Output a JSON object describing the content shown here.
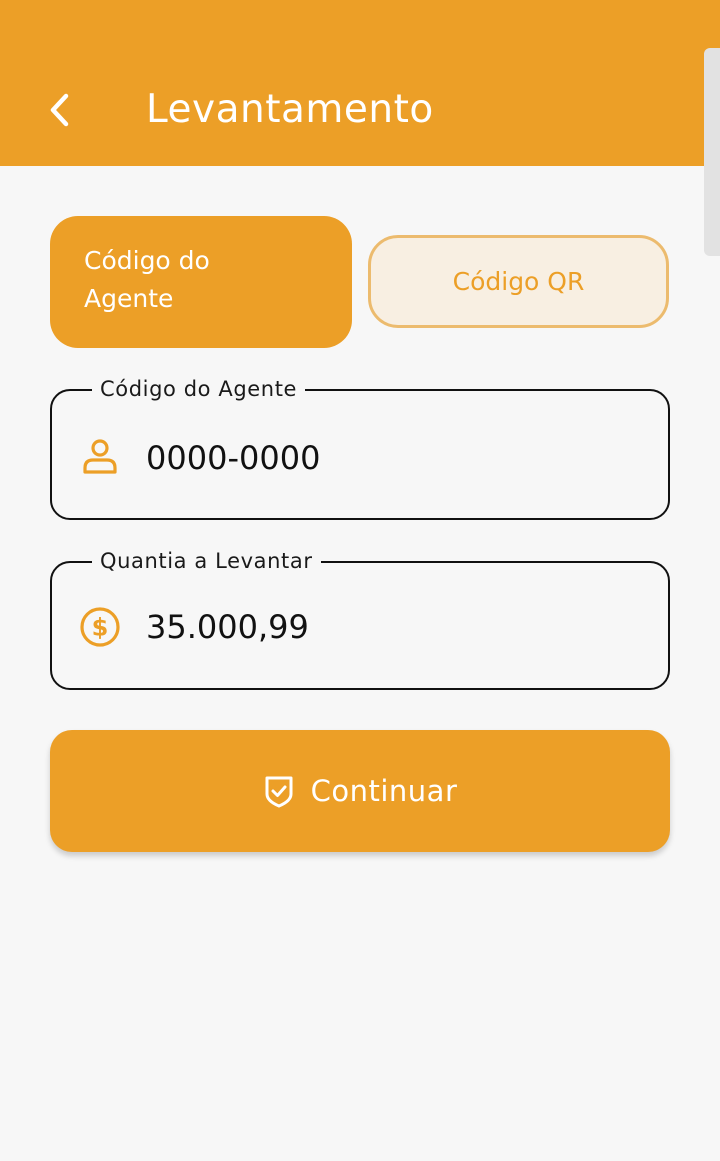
{
  "header": {
    "title": "Levantamento",
    "back_icon": "chevron-left-icon"
  },
  "toggle": {
    "agent_code_label": "Código do\nAgente",
    "qr_code_label": "Código QR",
    "selected": "agent_code"
  },
  "form": {
    "agent_code": {
      "label": "Código do Agente",
      "value": "0000-0000",
      "icon": "user-icon"
    },
    "amount": {
      "label": "Quantia a Levantar",
      "value": "35.000,99",
      "icon": "dollar-circle-icon"
    }
  },
  "actions": {
    "continue_label": "Continuar",
    "continue_icon": "shield-check-icon"
  },
  "colors": {
    "accent": "#ec9f27",
    "accent_light": "#f8efe2",
    "accent_border": "#ecbb6e",
    "background": "#f7f7f7",
    "text": "#111111"
  }
}
